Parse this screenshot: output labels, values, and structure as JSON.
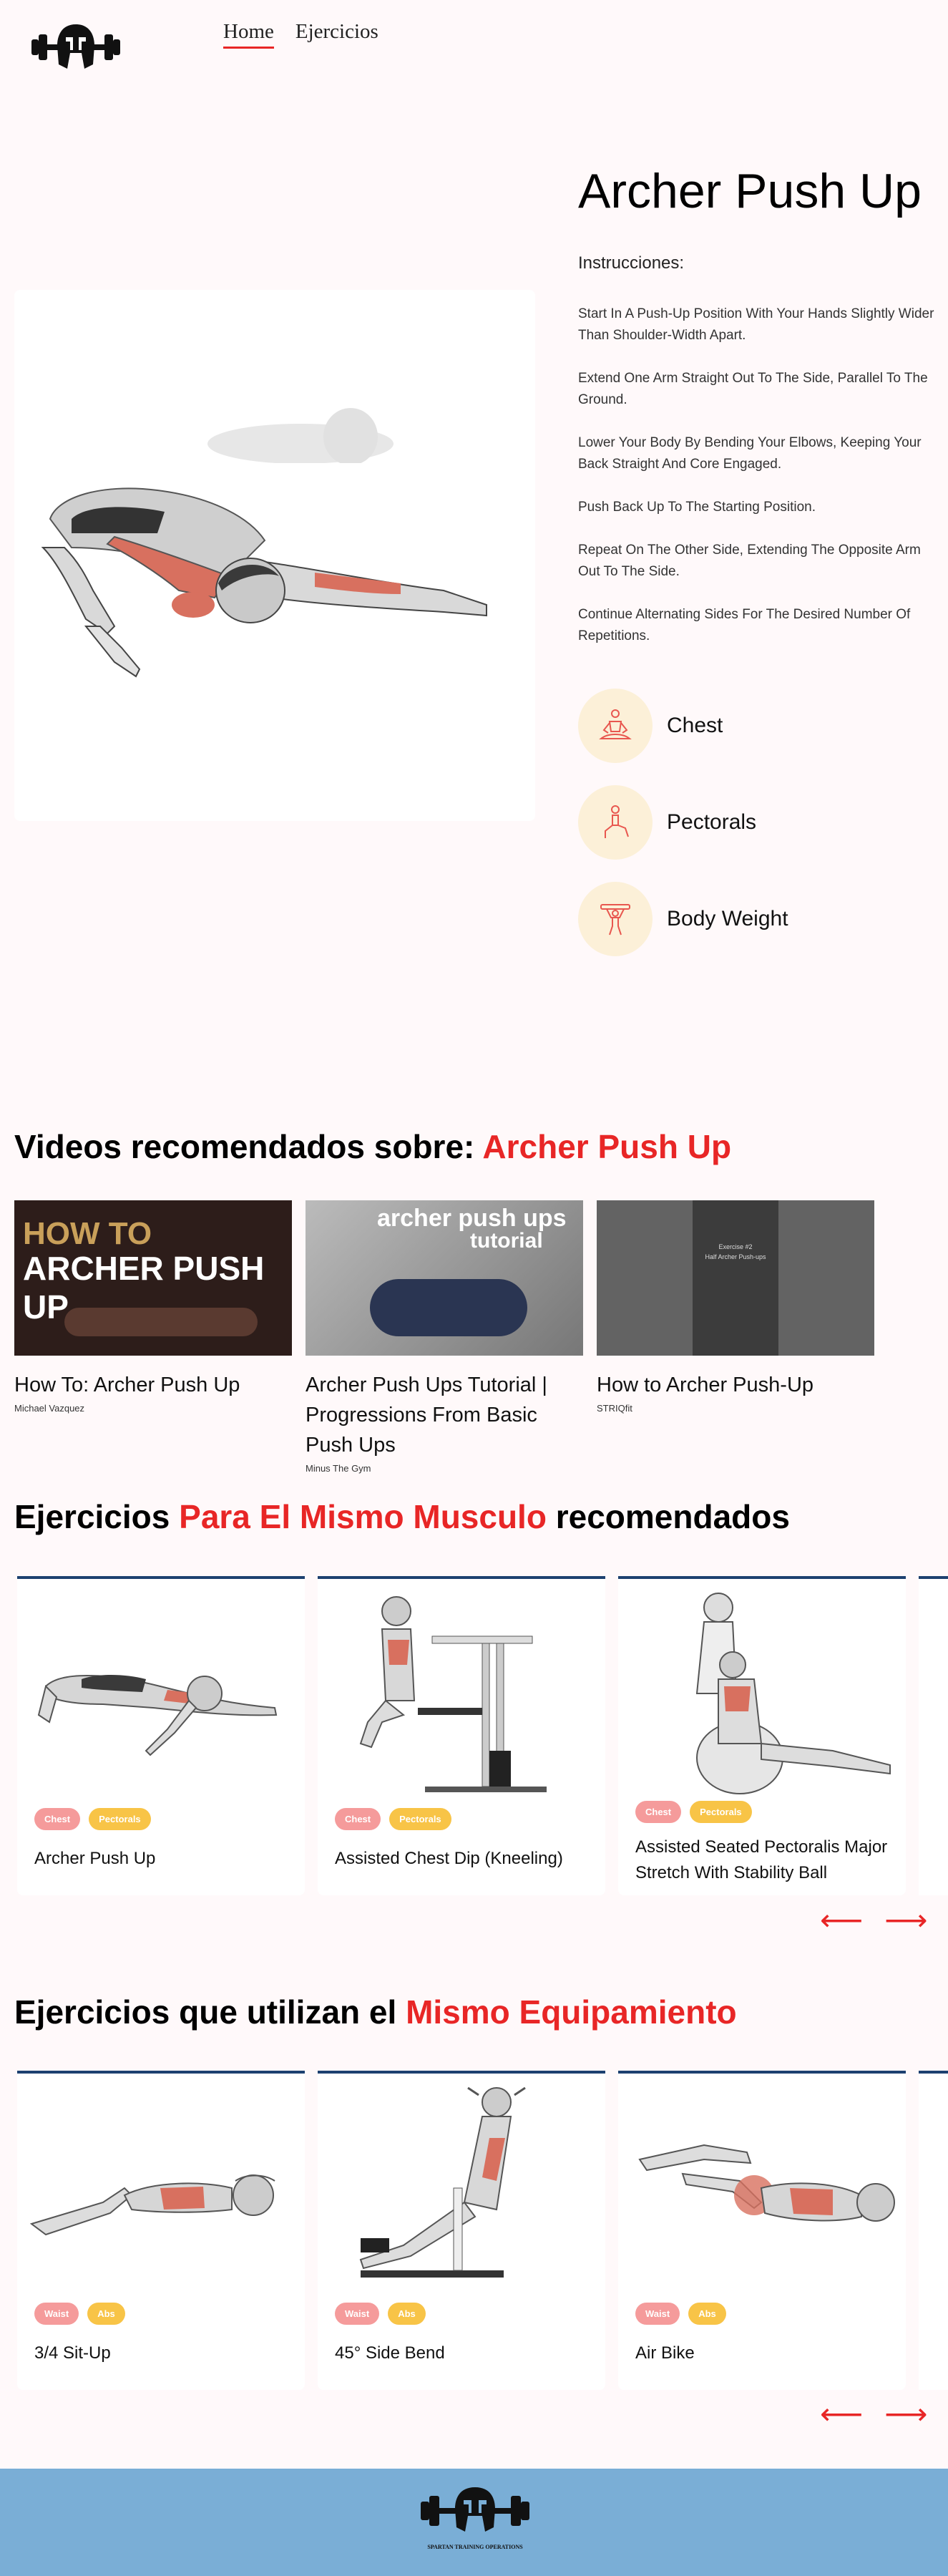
{
  "nav": {
    "home": "Home",
    "exercises": "Ejercicios"
  },
  "exercise": {
    "title": "Archer Push Up",
    "instructions_label": "Instrucciones:",
    "steps": [
      "Start In A Push-Up Position With Your Hands Slightly Wider Than Shoulder-Width Apart.",
      "Extend One Arm Straight Out To The Side, Parallel To The Ground.",
      "Lower Your Body By Bending Your Elbows, Keeping Your Back Straight And Core Engaged.",
      "Push Back Up To The Starting Position.",
      "Repeat On The Other Side, Extending The Opposite Arm Out To The Side.",
      "Continue Alternating Sides For The Desired Number Of Repetitions."
    ],
    "muscles": [
      {
        "label": "Chest",
        "icon": "meditation-icon"
      },
      {
        "label": "Pectorals",
        "icon": "lunge-icon"
      },
      {
        "label": "Body Weight",
        "icon": "dumbbell-lift-icon"
      }
    ]
  },
  "videos": {
    "heading_prefix": "Videos recomendados sobre: ",
    "heading_highlight": "Archer Push Up",
    "items": [
      {
        "title": "How To: Archer Push Up",
        "author": "Michael Vazquez",
        "thumb_text_1": "HOW TO",
        "thumb_text_2": "ARCHER PUSH UP"
      },
      {
        "title": "Archer Push Ups Tutorial | Progressions From Basic Push Ups",
        "author": "Minus The Gym",
        "thumb_text_1": "archer push ups",
        "thumb_text_2": "tutorial"
      },
      {
        "title": "How to Archer Push-Up",
        "author": "STRIQfit",
        "thumb_text_1": "Exercise #2",
        "thumb_text_2": "Half Archer Push-ups"
      }
    ]
  },
  "same_muscle": {
    "heading_prefix": "Ejercicios ",
    "heading_highlight": "Para El Mismo Musculo",
    "heading_suffix": " recomendados",
    "items": [
      {
        "name": "Archer Push Up",
        "tag1": "Chest",
        "tag2": "Pectorals"
      },
      {
        "name": "Assisted Chest Dip (Kneeling)",
        "tag1": "Chest",
        "tag2": "Pectorals"
      },
      {
        "name": "Assisted Seated Pectoralis Major Stretch With Stability Ball",
        "tag1": "Chest",
        "tag2": "Pectorals"
      }
    ]
  },
  "same_equipment": {
    "heading_prefix": "Ejercicios que utilizan el ",
    "heading_highlight": "Mismo Equipamiento",
    "items": [
      {
        "name": "3/4 Sit-Up",
        "tag1": "Waist",
        "tag2": "Abs"
      },
      {
        "name": "45° Side Bend",
        "tag1": "Waist",
        "tag2": "Abs"
      },
      {
        "name": "Air Bike",
        "tag1": "Waist",
        "tag2": "Abs"
      }
    ]
  },
  "arrows": {
    "prev": "⟵",
    "next": "⟶"
  },
  "footer": {
    "brand": "SPARTAN TRAINING OPERATIONS"
  },
  "colors": {
    "accent": "#e82626",
    "card_border": "#1d4170",
    "footer_bg": "#7aaed6",
    "tag_muscle": "#f59b9b",
    "tag_part": "#f8c447"
  }
}
